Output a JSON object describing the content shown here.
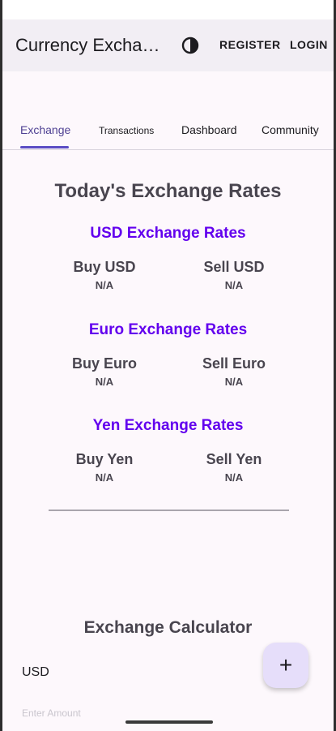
{
  "app_bar": {
    "title": "Currency Exchan…",
    "theme_toggle_icon": "contrast-icon",
    "register_label": "REGISTER",
    "login_label": "LOGIN"
  },
  "tabs": [
    {
      "label": "Exchange",
      "active": true
    },
    {
      "label": "Transactions",
      "active": false
    },
    {
      "label": "Dashboard",
      "active": false
    },
    {
      "label": "Community",
      "active": false
    }
  ],
  "rates": {
    "title": "Today's Exchange Rates",
    "sections": [
      {
        "title": "USD Exchange Rates",
        "buy_label": "Buy USD",
        "buy_value": "N/A",
        "sell_label": "Sell USD",
        "sell_value": "N/A"
      },
      {
        "title": "Euro Exchange Rates",
        "buy_label": "Buy Euro",
        "buy_value": "N/A",
        "sell_label": "Sell Euro",
        "sell_value": "N/A"
      },
      {
        "title": "Yen Exchange Rates",
        "buy_label": "Buy Yen",
        "buy_value": "N/A",
        "sell_label": "Sell Yen",
        "sell_value": "N/A"
      }
    ]
  },
  "calculator": {
    "title": "Exchange Calculator",
    "currency": "USD",
    "next_field_label": "Enter Amount"
  },
  "fab": {
    "label": "+",
    "icon": "add-icon"
  },
  "colors": {
    "accent": "#6200ee",
    "tab_indicator": "#5b4cc4",
    "app_bar": "#f2eef4",
    "background": "#fdf8fc",
    "fab": "#e6defa"
  }
}
